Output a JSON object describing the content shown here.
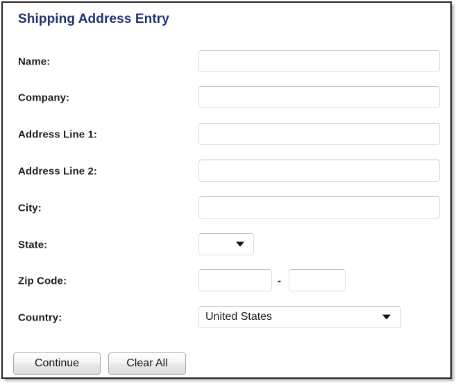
{
  "form": {
    "title": "Shipping Address Entry",
    "fields": [
      {
        "label": "Name:",
        "type": "text",
        "value": "",
        "placeholder": ""
      },
      {
        "label": "Company:",
        "type": "text",
        "value": "",
        "placeholder": ""
      },
      {
        "label": "Address Line 1:",
        "type": "text",
        "value": "",
        "placeholder": ""
      },
      {
        "label": "Address Line 2:",
        "type": "text",
        "value": "",
        "placeholder": ""
      },
      {
        "label": "City:",
        "type": "text",
        "value": "",
        "placeholder": ""
      },
      {
        "label": "State:",
        "type": "select",
        "value": ""
      },
      {
        "label": "Zip Code:",
        "type": "zip",
        "value": "",
        "value2": "",
        "separator": "-"
      },
      {
        "label": "Country:",
        "type": "select",
        "value": "United States"
      }
    ],
    "buttons": {
      "continue_label": "Continue",
      "clear_all_label": "Clear All"
    },
    "icons": {
      "state_dropdown": "chevron-down-icon",
      "country_dropdown": "chevron-down-icon"
    },
    "colors": {
      "title": "#1f2f72",
      "label": "#1b1b1b",
      "input_border": "#dcdcdc",
      "frame_border": "#242424",
      "button_border": "#a8a8a8",
      "background": "#ffffff"
    }
  }
}
